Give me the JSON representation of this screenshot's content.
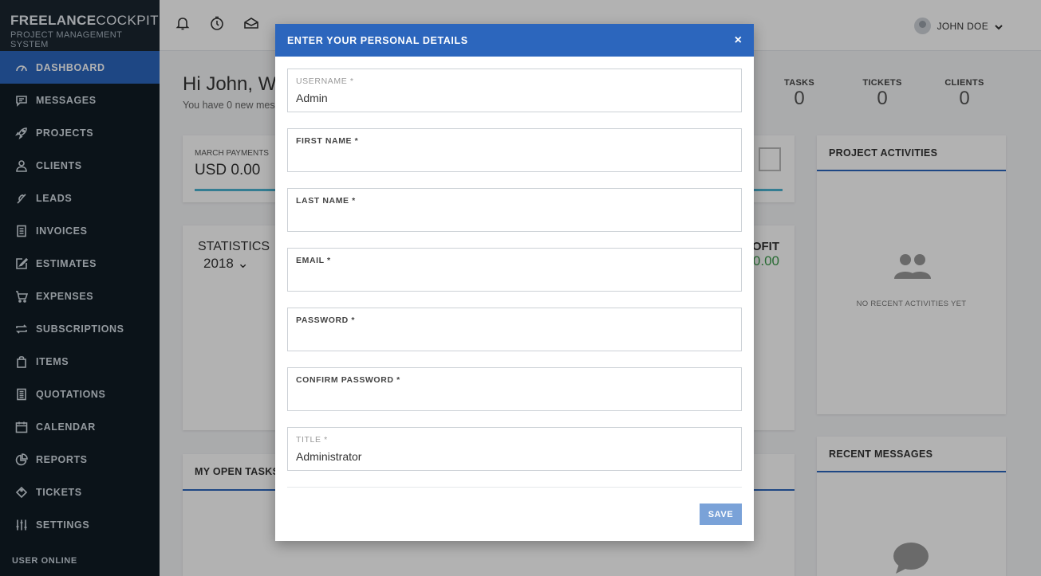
{
  "brand": {
    "name_bold": "FREELANCE",
    "name_light": "COCKPIT",
    "subtitle": "PROJECT MANAGEMENT SYSTEM"
  },
  "sidebar": {
    "items": [
      {
        "label": "DASHBOARD",
        "icon": "dashboard-icon",
        "active": true
      },
      {
        "label": "MESSAGES",
        "icon": "message-icon"
      },
      {
        "label": "PROJECTS",
        "icon": "rocket-icon"
      },
      {
        "label": "CLIENTS",
        "icon": "user-icon"
      },
      {
        "label": "LEADS",
        "icon": "phone-icon"
      },
      {
        "label": "INVOICES",
        "icon": "invoice-icon"
      },
      {
        "label": "ESTIMATES",
        "icon": "edit-icon"
      },
      {
        "label": "EXPENSES",
        "icon": "cart-icon"
      },
      {
        "label": "SUBSCRIPTIONS",
        "icon": "repeat-icon"
      },
      {
        "label": "ITEMS",
        "icon": "bag-icon"
      },
      {
        "label": "QUOTATIONS",
        "icon": "list-icon"
      },
      {
        "label": "CALENDAR",
        "icon": "calendar-icon"
      },
      {
        "label": "REPORTS",
        "icon": "pie-chart-icon"
      },
      {
        "label": "TICKETS",
        "icon": "ticket-icon"
      },
      {
        "label": "SETTINGS",
        "icon": "sliders-icon"
      }
    ],
    "footer": "USER ONLINE"
  },
  "topbar": {
    "user_name": "JOHN DOE"
  },
  "dashboard": {
    "greeting": "Hi John, W",
    "greeting_sub": "You have 0 new mes",
    "stats": [
      {
        "label": "TASKS",
        "value": "0"
      },
      {
        "label": "TICKETS",
        "value": "0"
      },
      {
        "label": "CLIENTS",
        "value": "0"
      }
    ],
    "payments": {
      "label": "MARCH PAYMENTS",
      "value": "USD 0.00"
    },
    "statistics": {
      "title": "STATISTICS",
      "year": "2018"
    },
    "profit": {
      "label": "ROFIT",
      "value": "0.00"
    },
    "open_tasks_title": "MY OPEN TASKS",
    "project_activities": {
      "title": "PROJECT ACTIVITIES",
      "empty": "NO RECENT ACTIVITIES YET"
    },
    "recent_messages_title": "RECENT MESSAGES"
  },
  "modal": {
    "title": "ENTER YOUR PERSONAL DETAILS",
    "close": "×",
    "fields": [
      {
        "label": "USERNAME *",
        "value": "Admin"
      },
      {
        "label": "FIRST NAME *",
        "value": ""
      },
      {
        "label": "LAST NAME *",
        "value": ""
      },
      {
        "label": "EMAIL *",
        "value": ""
      },
      {
        "label": "PASSWORD *",
        "value": ""
      },
      {
        "label": "CONFIRM PASSWORD *",
        "value": ""
      },
      {
        "label": "TITLE *",
        "value": "Administrator"
      }
    ],
    "save_label": "SAVE"
  },
  "colors": {
    "accent": "#2c66bd",
    "sidebar_bg": "#111c25",
    "save_button": "#7aa2d8",
    "profit_value": "#3a9a4a"
  }
}
